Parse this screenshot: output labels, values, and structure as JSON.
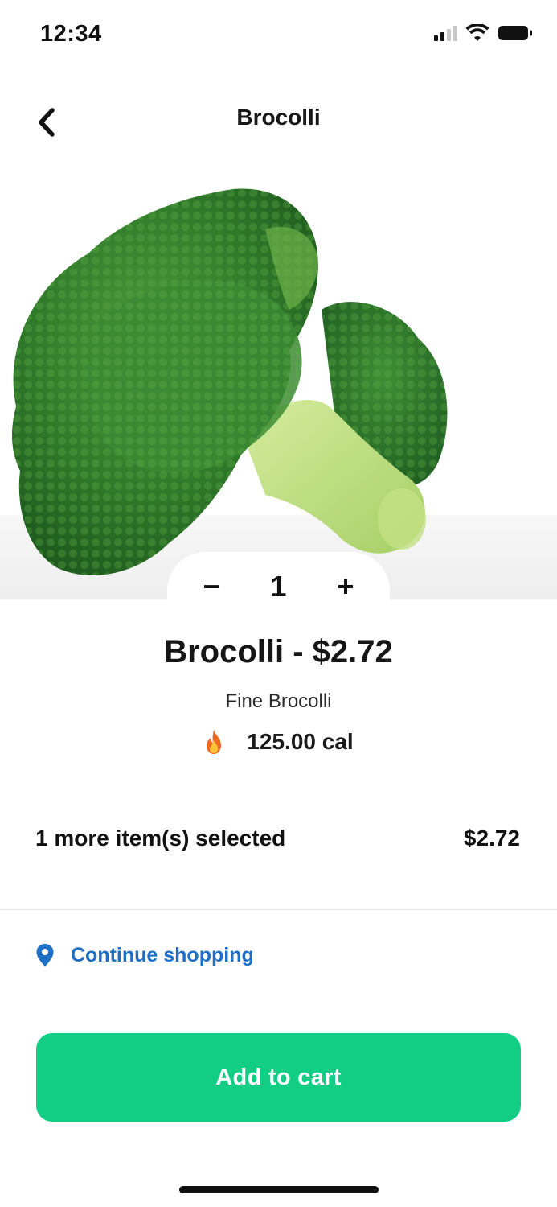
{
  "status_bar": {
    "time": "12:34"
  },
  "header": {
    "title": "Brocolli",
    "back_icon": "chevron-left-icon"
  },
  "product": {
    "image_icon": "broccoli-image",
    "title": "Brocolli - $2.72",
    "description": "Fine Brocolli",
    "calories_icon": "fire-icon",
    "calories": "125.00 cal"
  },
  "stepper": {
    "decrement": "−",
    "value": "1",
    "increment": "+"
  },
  "summary": {
    "label": "1 more item(s) selected",
    "total": "$2.72"
  },
  "continue_shopping": {
    "icon": "map-pin-icon",
    "label": "Continue shopping"
  },
  "add_to_cart": {
    "label": "Add to cart"
  },
  "colors": {
    "accent": "#12cd84",
    "link": "#1f6fc5"
  }
}
